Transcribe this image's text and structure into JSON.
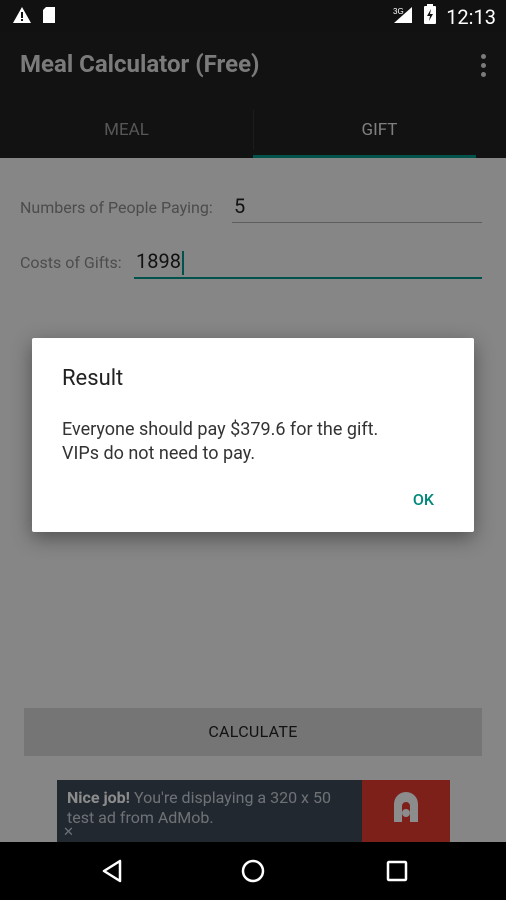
{
  "status_bar": {
    "time": "12:13",
    "network": "3G"
  },
  "app": {
    "title": "Meal Calculator (Free)"
  },
  "tabs": [
    {
      "label": "MEAL"
    },
    {
      "label": "GIFT"
    }
  ],
  "form": {
    "people_label": "Numbers of People Paying:",
    "people_value": "5",
    "gifts_label": "Costs of Gifts:",
    "gifts_value": "1898"
  },
  "calculate_label": "CALCULATE",
  "ad": {
    "headline": "Nice job!",
    "text": "You're displaying a 320 x 50 test ad from AdMob.",
    "close": "✕"
  },
  "dialog": {
    "title": "Result",
    "message": "Everyone should pay $379.6 for the gift.\nVIPs do not need to pay.",
    "ok_label": "OK"
  },
  "colors": {
    "accent": "#009688",
    "appbar": "#212121",
    "statusbar": "#111111"
  }
}
